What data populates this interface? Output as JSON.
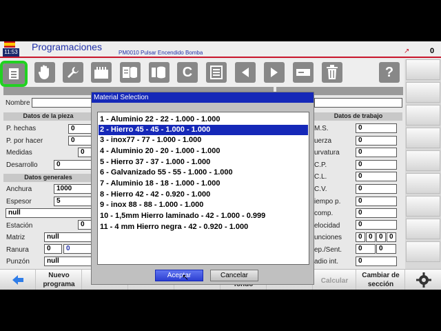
{
  "title_bar": {
    "time": "11:53",
    "app_title": "Programaciones",
    "subtitle": "PM0010 Pulsar Encendido Bomba",
    "counter": "0"
  },
  "toolbar": {
    "icons": [
      "document-icon",
      "hand-icon",
      "wrench-icon",
      "factory-icon",
      "database-list-icon",
      "database-gear-icon",
      "c-letter-icon",
      "list-form-icon",
      "arrow-left-icon",
      "arrow-right-icon",
      "minus-bar-icon",
      "trash-icon",
      "help-icon"
    ],
    "c_label": "C",
    "help_label": "?"
  },
  "form": {
    "nombre_label": "Nombre",
    "datos_pieza": {
      "title": "Datos de la pieza",
      "rows": [
        {
          "label": "P. hechas",
          "value": "0"
        },
        {
          "label": "P. por hacer",
          "value": "0"
        },
        {
          "label": "Medidas",
          "value": "0"
        },
        {
          "label": "Desarrollo",
          "value": "0"
        }
      ]
    },
    "datos_generales": {
      "title": "Datos generales",
      "anchura_label": "Anchura",
      "anchura_value": "1000",
      "espesor_label": "Espesor",
      "espesor_value": "5",
      "null_value": "null",
      "estacion_label": "Estación",
      "estacion_value": "0",
      "matriz_label": "Matriz",
      "matriz_value": "null",
      "ranura_label": "Ranura",
      "ranura_value1": "0",
      "ranura_value2": "0",
      "punzon_label": "Punzón",
      "punzon_value": "null"
    },
    "datos_trabajo": {
      "title": "Datos de trabajo",
      "rows": [
        {
          "label": "M.S.",
          "value": "0"
        },
        {
          "label": "uerza",
          "value": "0"
        },
        {
          "label": "urvatura",
          "value": "0"
        },
        {
          "label": "C.P.",
          "value": "0"
        },
        {
          "label": "C.L.",
          "value": "0"
        },
        {
          "label": "C.V.",
          "value": "0"
        },
        {
          "label": "iempo p.",
          "value": "0"
        },
        {
          "label": "comp.",
          "value": "0"
        },
        {
          "label": "elocidad",
          "value": "0"
        }
      ],
      "funciones_label": "unciones",
      "funciones_values": [
        "0",
        "0",
        "0",
        "0"
      ],
      "rep_label": "ep./Sent.",
      "rep_values": [
        "0",
        "0"
      ],
      "radio_label": "adio int.",
      "radio_value": "0"
    }
  },
  "bottom_bar": {
    "nuevo_programa": "Nuevo\nprograma",
    "fondo": "fondo",
    "calcular": "Calcular",
    "cambiar_seccion": "Cambiar de\nsección"
  },
  "modal": {
    "title": "Material Selection",
    "items": [
      "1 - Aluminio 22 - 22 - 1.000 - 1.000",
      "2 - Hierro 45 - 45 - 1.000 - 1.000",
      "3 - inox77 - 77 - 1.000 - 1.000",
      "4 - Aluminio 20 - 20 - 1.000 - 1.000",
      "5 - Hierro 37 - 37 - 1.000 - 1.000",
      "6 - Galvanizado 55 - 55 - 1.000 - 1.000",
      "7 - Aluminio 18 - 18 - 1.000 - 1.000",
      "8 - Hierro 42 - 42 - 0.920 - 1.000",
      "9 - inox 88 - 88 - 1.000 - 1.000",
      "10 - 1,5mm Hierro laminado - 42 - 1.000 - 0.999",
      "11 - 4 mm Hierro negra - 42 - 0.920 - 1.000"
    ],
    "selected_index": 1,
    "accept_label": "Aceptar",
    "cancel_label": "Cancelar"
  },
  "colors": {
    "accent_blue": "#1528b8",
    "title_red": "#c8142a",
    "active_green": "#21d121"
  }
}
